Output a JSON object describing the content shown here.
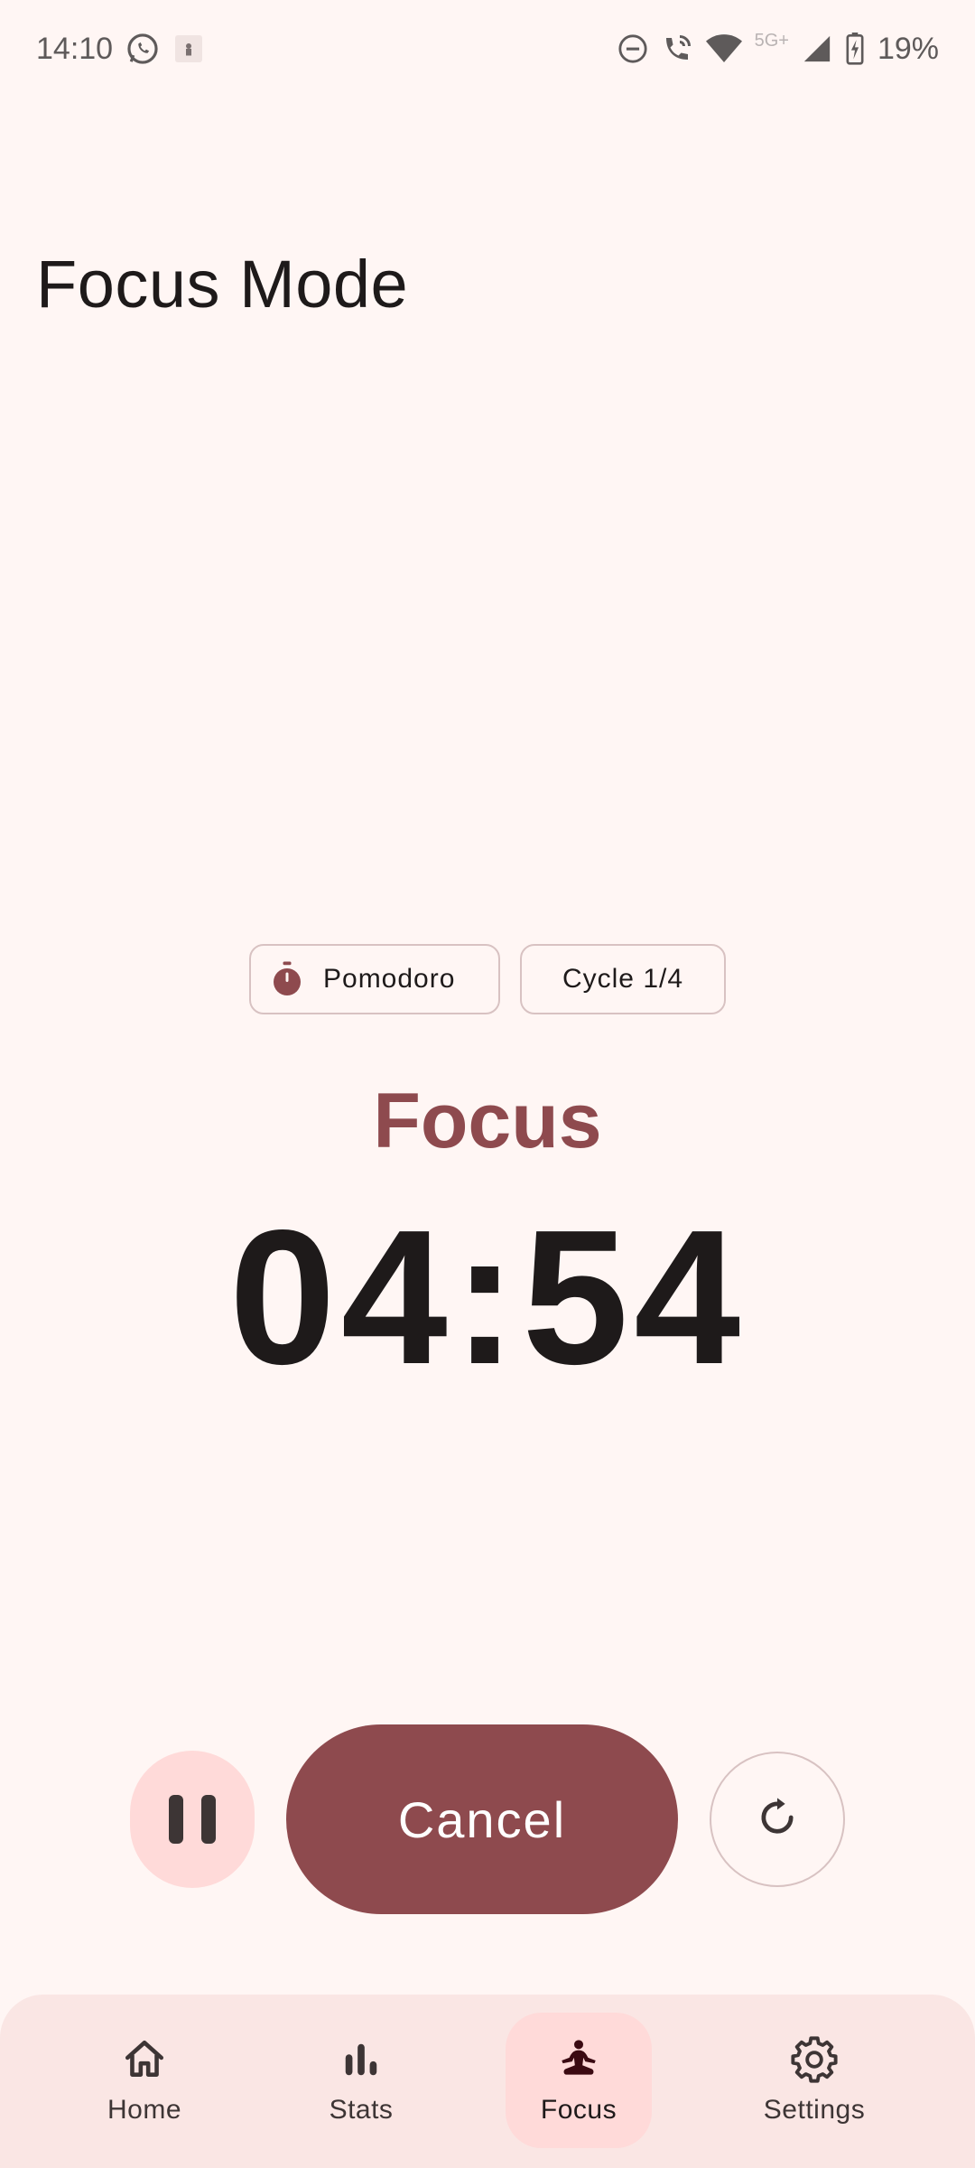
{
  "status_bar": {
    "time": "14:10",
    "battery": "19%",
    "network": "5G+"
  },
  "page": {
    "title": "Focus Mode"
  },
  "chips": {
    "mode_label": "Pomodoro",
    "cycle_label": "Cycle 1/4"
  },
  "timer": {
    "phase": "Focus",
    "remaining": "04:54"
  },
  "controls": {
    "cancel_label": "Cancel"
  },
  "nav": {
    "items": [
      {
        "label": "Home",
        "icon": "home-icon"
      },
      {
        "label": "Stats",
        "icon": "bar-chart-icon"
      },
      {
        "label": "Focus",
        "icon": "meditation-icon",
        "active": true
      },
      {
        "label": "Settings",
        "icon": "gear-icon"
      }
    ]
  },
  "colors": {
    "accent": "#8e4a4e",
    "background": "#fff6f4",
    "nav_background": "#fae6e4",
    "active_pill": "#ffdad9"
  }
}
